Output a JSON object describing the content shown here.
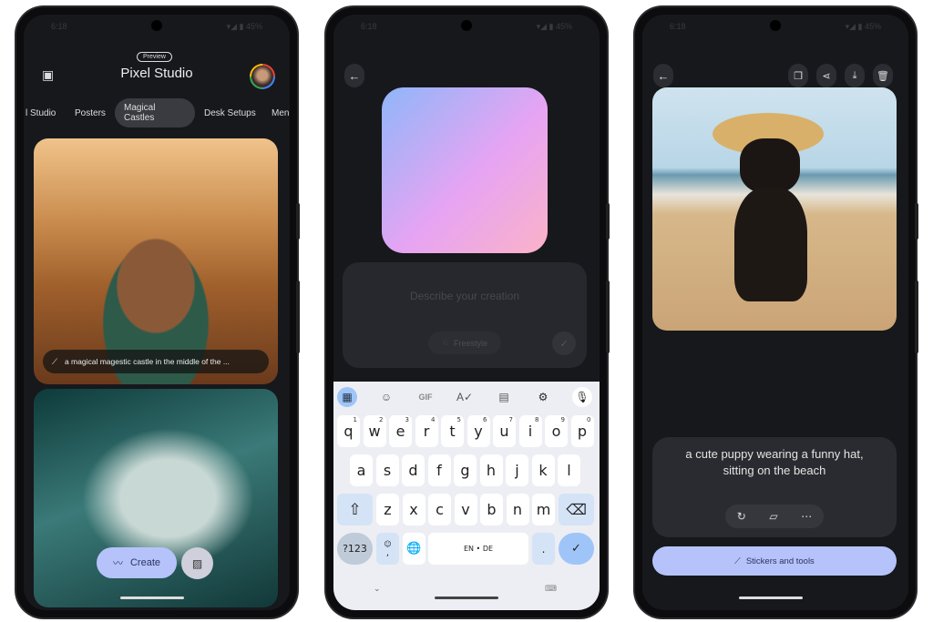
{
  "status_bar": {
    "time": "6:18",
    "battery": "45%"
  },
  "phone1": {
    "badge": "Preview",
    "title": "Pixel Studio",
    "tabs": [
      {
        "label": "l Studio"
      },
      {
        "label": "Posters"
      },
      {
        "label": "Magical Castles",
        "active": true
      },
      {
        "label": "Desk Setups"
      },
      {
        "label": "Men"
      }
    ],
    "card_caption": "a magical magestic castle in the middle of the ...",
    "create_label": "Create",
    "icons": [
      "gallery-icon",
      "avatar",
      "wand-icon",
      "squiggle-icon",
      "add-image-icon"
    ]
  },
  "phone2": {
    "prompt_placeholder": "Describe your creation",
    "style_label": "Freestyle",
    "keyboard": {
      "toolbar": [
        "apps-icon",
        "sticker-icon",
        "GIF",
        "spellcheck-icon",
        "clipboard-icon",
        "gear-icon",
        "mic-icon"
      ],
      "row1": [
        [
          "q",
          "1"
        ],
        [
          "w",
          "2"
        ],
        [
          "e",
          "3"
        ],
        [
          "r",
          "4"
        ],
        [
          "t",
          "5"
        ],
        [
          "y",
          "6"
        ],
        [
          "u",
          "7"
        ],
        [
          "i",
          "8"
        ],
        [
          "o",
          "9"
        ],
        [
          "p",
          "0"
        ]
      ],
      "row2": [
        "a",
        "s",
        "d",
        "f",
        "g",
        "h",
        "j",
        "k",
        "l"
      ],
      "row3": [
        "z",
        "x",
        "c",
        "v",
        "b",
        "n",
        "m"
      ],
      "symbols": "?123",
      "space": "EN • DE",
      "period": ".",
      "comma": ","
    },
    "gradient_colors": [
      "#8fb6f9",
      "#e6a4f3",
      "#fbb2c8"
    ]
  },
  "phone3": {
    "caption": "a cute puppy wearing a funny hat, sitting on the beach",
    "tools_label": "Stickers and tools",
    "accent": "#b6c3fb"
  }
}
